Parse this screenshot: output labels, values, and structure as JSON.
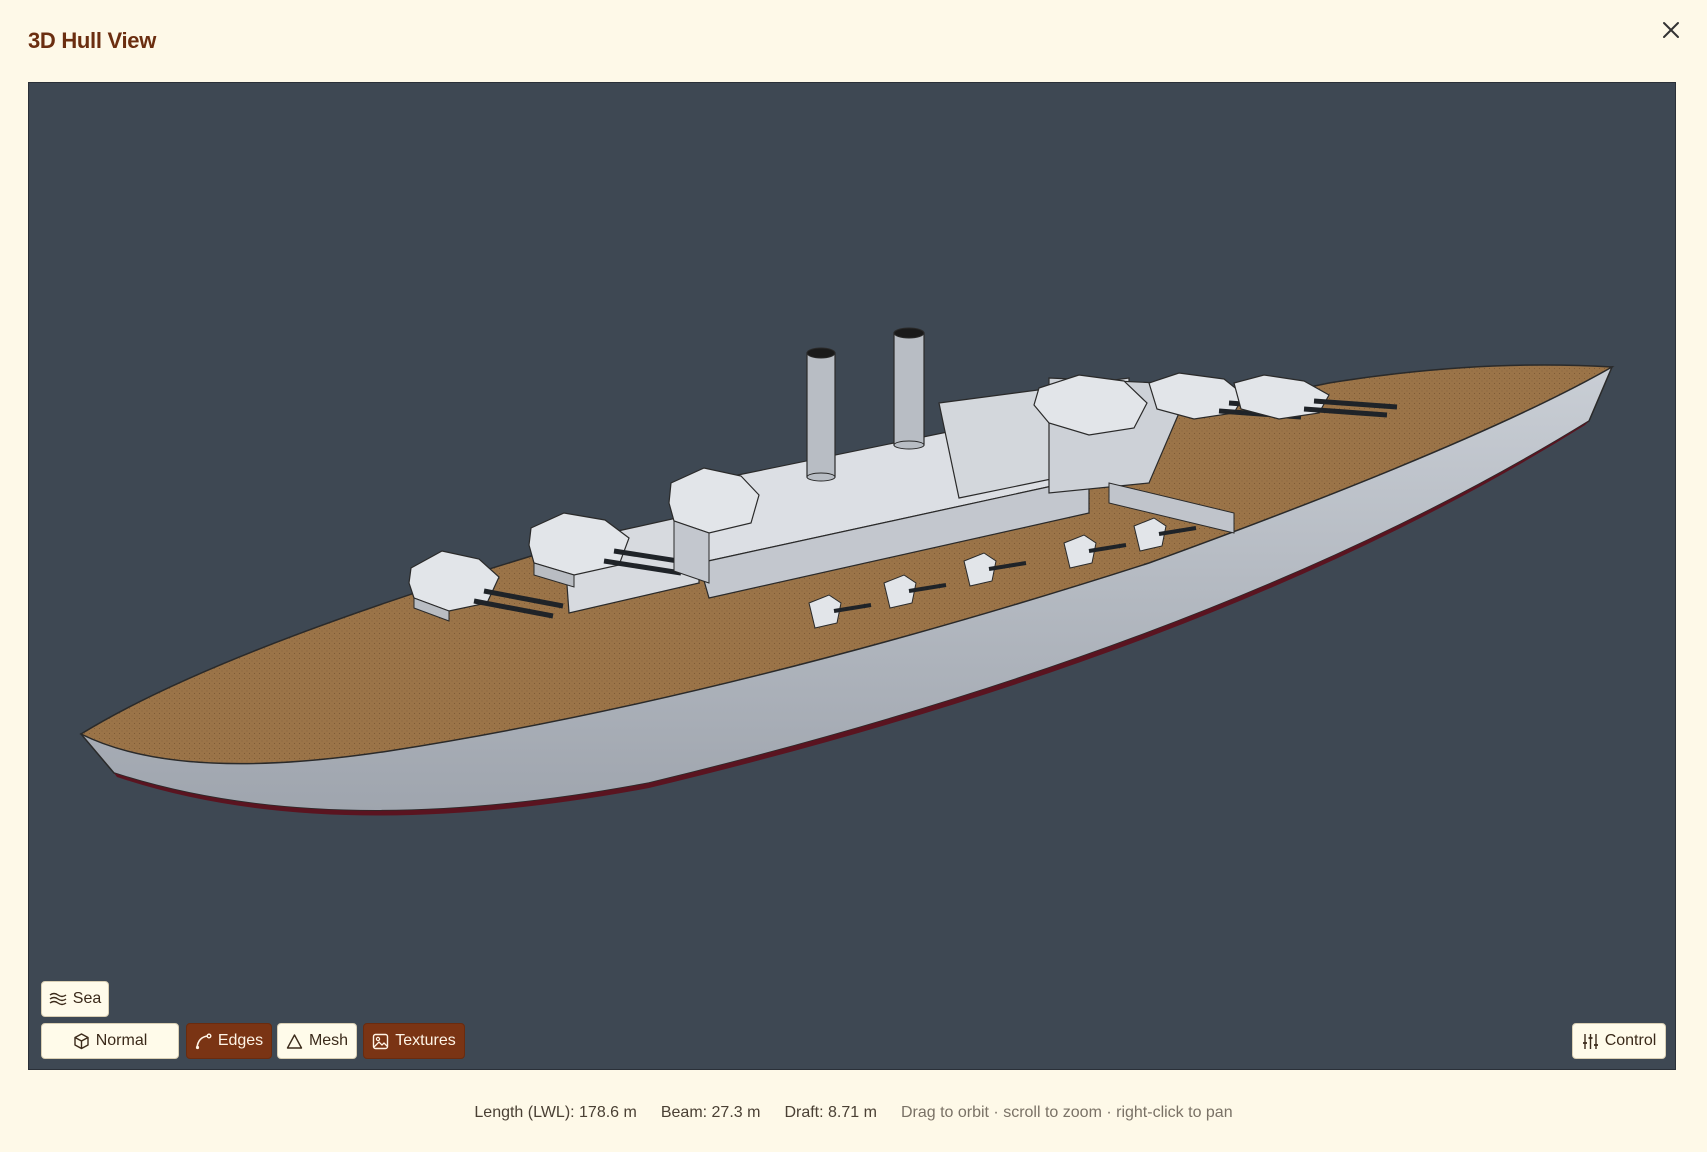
{
  "dialog": {
    "title": "3D Hull View",
    "close_icon": "close-icon"
  },
  "viewport": {
    "background": "#3e4853",
    "deck_color": "#9b7448",
    "hull_color": "#b9bec6"
  },
  "toolbar": {
    "sea_label": "Sea",
    "normal_label": "Normal",
    "edges_label": "Edges",
    "mesh_label": "Mesh",
    "textures_label": "Textures",
    "control_label": "Control",
    "active_color": "#7a3414"
  },
  "status": {
    "length": "Length (LWL): 178.6 m",
    "beam": "Beam: 27.3 m",
    "draft": "Draft: 8.71 m",
    "hint": "Drag to orbit · scroll to zoom · right-click to pan"
  }
}
